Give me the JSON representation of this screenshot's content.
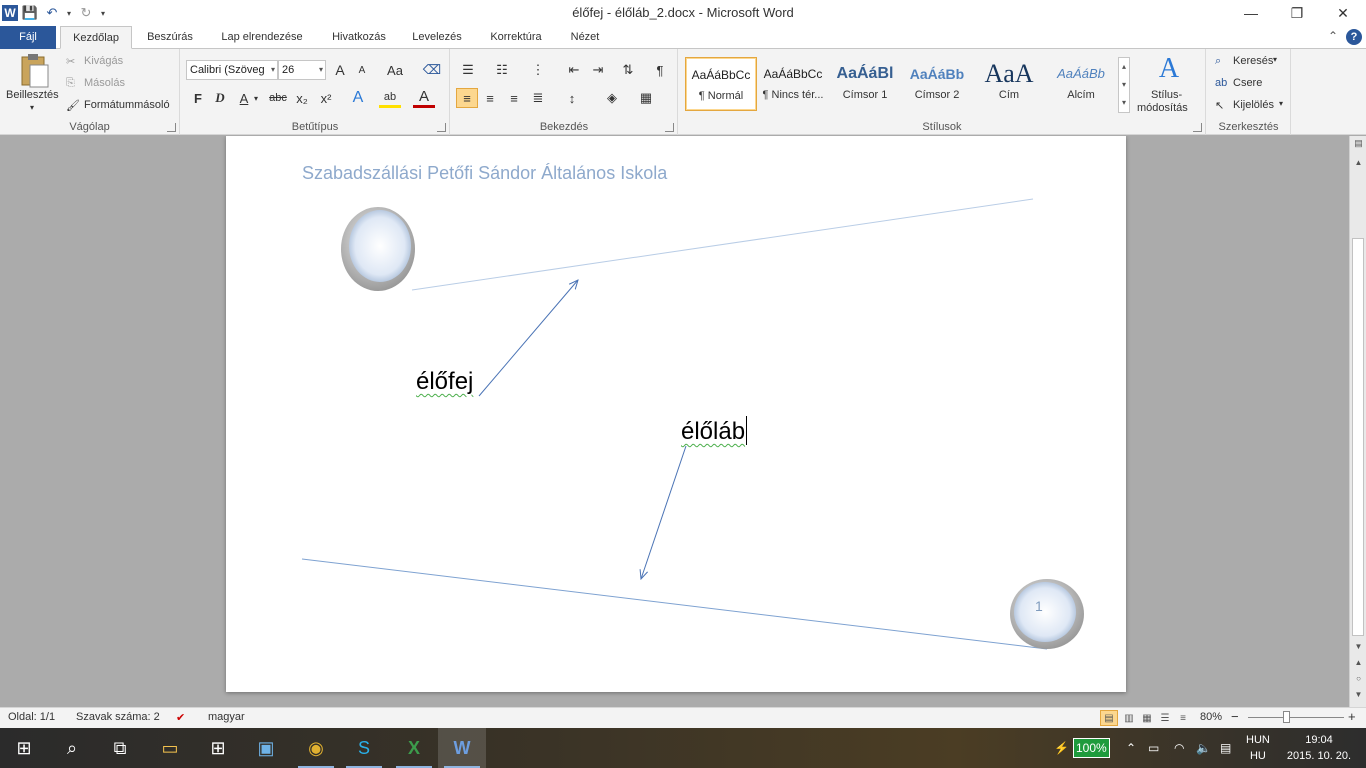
{
  "window": {
    "title": "élőfej - élőláb_2.docx - Microsoft Word",
    "minimize": "—",
    "restore": "❐",
    "close": "✕"
  },
  "quick_access": {
    "app_icon": "W",
    "save": "💾",
    "undo": "↶",
    "redo": "↻",
    "customize": "▾"
  },
  "tabs": [
    {
      "label": "Fájl"
    },
    {
      "label": "Kezdőlap"
    },
    {
      "label": "Beszúrás"
    },
    {
      "label": "Lap elrendezése"
    },
    {
      "label": "Hivatkozás"
    },
    {
      "label": "Levelezés"
    },
    {
      "label": "Korrektúra"
    },
    {
      "label": "Nézet"
    }
  ],
  "ribbon": {
    "clipboard": {
      "label": "Vágólap",
      "paste": "Beillesztés",
      "cut": "Kivágás",
      "copy": "Másolás",
      "format_painter": "Formátummásoló"
    },
    "font": {
      "label": "Betűtípus",
      "font_name": "Calibri (Szöveg",
      "font_size": "26",
      "grow": "A",
      "shrink": "A",
      "case": "Aa",
      "bold": "F",
      "italic": "D",
      "underline": "A",
      "strike": "abc",
      "subscript": "x₂",
      "superscript": "x²",
      "text_effect": "A",
      "highlight": "ab",
      "font_color": "A"
    },
    "paragraph": {
      "label": "Bekezdés",
      "pilcrow": "¶"
    },
    "styles": {
      "label": "Stílusok",
      "items": [
        {
          "sample": "AaÁáBbCc",
          "name": "¶ Normál"
        },
        {
          "sample": "AaÁáBbCc",
          "name": "¶ Nincs tér..."
        },
        {
          "sample": "AaÁáBl",
          "name": "Címsor 1"
        },
        {
          "sample": "AaÁáBb",
          "name": "Címsor 2"
        },
        {
          "sample": "AaA",
          "name": "Cím"
        },
        {
          "sample": "AaÁáBb",
          "name": "Alcím"
        }
      ],
      "change_label_1": "Stílus-",
      "change_label_2": "módosítás"
    },
    "editing": {
      "label": "Szerkesztés",
      "find": "Keresés",
      "replace": "Csere",
      "select": "Kijelölés"
    }
  },
  "document": {
    "header_text": "Szabadszállási Petőfi Sándor Általános Iskola",
    "label_header": "élőfej",
    "label_footer": "élőláb",
    "page_number": "1"
  },
  "statusbar": {
    "page": "Oldal: 1/1",
    "words": "Szavak száma: 2",
    "language": "magyar",
    "zoom": "80%",
    "zoom_minus": "−",
    "zoom_plus": "+"
  },
  "taskbar": {
    "battery": "100%",
    "lang_1": "HUN",
    "lang_2": "HU",
    "time": "19:04",
    "date": "2015. 10. 20."
  },
  "colors": {
    "word_blue": "#2b579a",
    "header_text": "#8ea9cc",
    "line": "#7ea2d1",
    "selected_style_border": "#e4a73f"
  }
}
